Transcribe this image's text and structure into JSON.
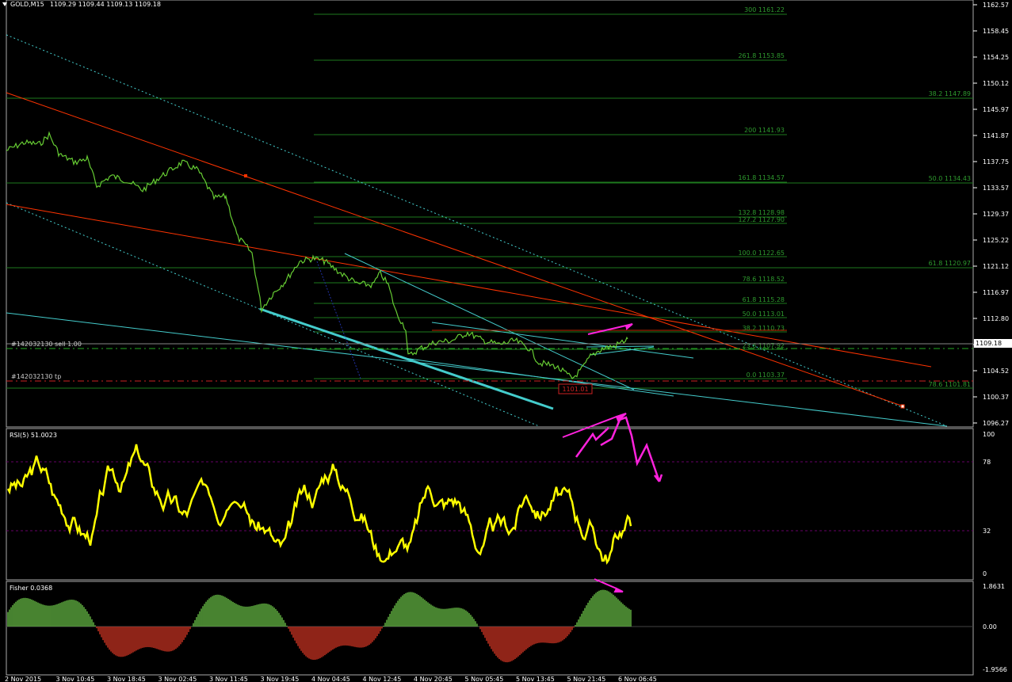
{
  "header": {
    "symbol": "GOLD,M15",
    "ohlc": "1109.29 1109.44 1109.13 1109.18"
  },
  "colors": {
    "bg": "#000000",
    "price": "#66cc33",
    "rsi": "#ffff00",
    "fisher_up": "#66bb44",
    "fisher_down": "#cc3322",
    "fib": "#1e7a1e",
    "fib_text": "#2e9a2e",
    "trend_red": "#ff3300",
    "channel": "#44cccc",
    "magenta": "#ff22dd",
    "axis": "#ffffff"
  },
  "price_axis": [
    "1162.57",
    "1158.45",
    "1154.25",
    "1150.12",
    "1145.97",
    "1141.87",
    "1137.75",
    "1133.57",
    "1129.37",
    "1125.22",
    "1121.12",
    "1116.97",
    "1112.80",
    "1109.18",
    "1104.52",
    "1100.37",
    "1096.27"
  ],
  "current_price": "1109.18",
  "fib_levels_left": [
    {
      "label": "300  1161.22"
    },
    {
      "label": "261.8  1153.85"
    },
    {
      "label": "200  1141.93"
    },
    {
      "label": "161.8  1134.57"
    },
    {
      "label": "132.8  1128.98"
    },
    {
      "label": "127.2  1127.90"
    },
    {
      "label": "100.0  1122.65"
    },
    {
      "label": "78.6  1118.52"
    },
    {
      "label": "61.8  1115.28"
    },
    {
      "label": "50.0   1113.01"
    },
    {
      "label": "38.2  1110.73"
    },
    {
      "label": "23.6  1107.92"
    },
    {
      "label": "0.0  1103.37"
    }
  ],
  "fib_levels_right": [
    {
      "label": "38.2  1147.89"
    },
    {
      "label": "50.0  1134.43"
    },
    {
      "label": "61.8  1120.97"
    },
    {
      "label": "78.6  1101.81"
    }
  ],
  "orders": {
    "sell": "#142032130 sell 1.00",
    "tp": "#142032130 tp",
    "low_marker": "1101.01"
  },
  "rsi": {
    "title": "RSI(5) 51.0023",
    "axis": [
      "100",
      "78",
      "32",
      "0"
    ]
  },
  "fisher": {
    "title": "Fisher 0.0368",
    "axis": [
      "1.8631",
      "0.00",
      "-1.9566"
    ]
  },
  "time_axis": [
    "2 Nov 2015",
    "3 Nov 10:45",
    "3 Nov 18:45",
    "3 Nov 02:45",
    "3 Nov 11:45",
    "3 Nov 19:45",
    "4 Nov 04:45",
    "4 Nov 12:45",
    "4 Nov 20:45",
    "5 Nov 05:45",
    "5 Nov 13:45",
    "5 Nov 21:45",
    "6 Nov 06:45"
  ]
}
